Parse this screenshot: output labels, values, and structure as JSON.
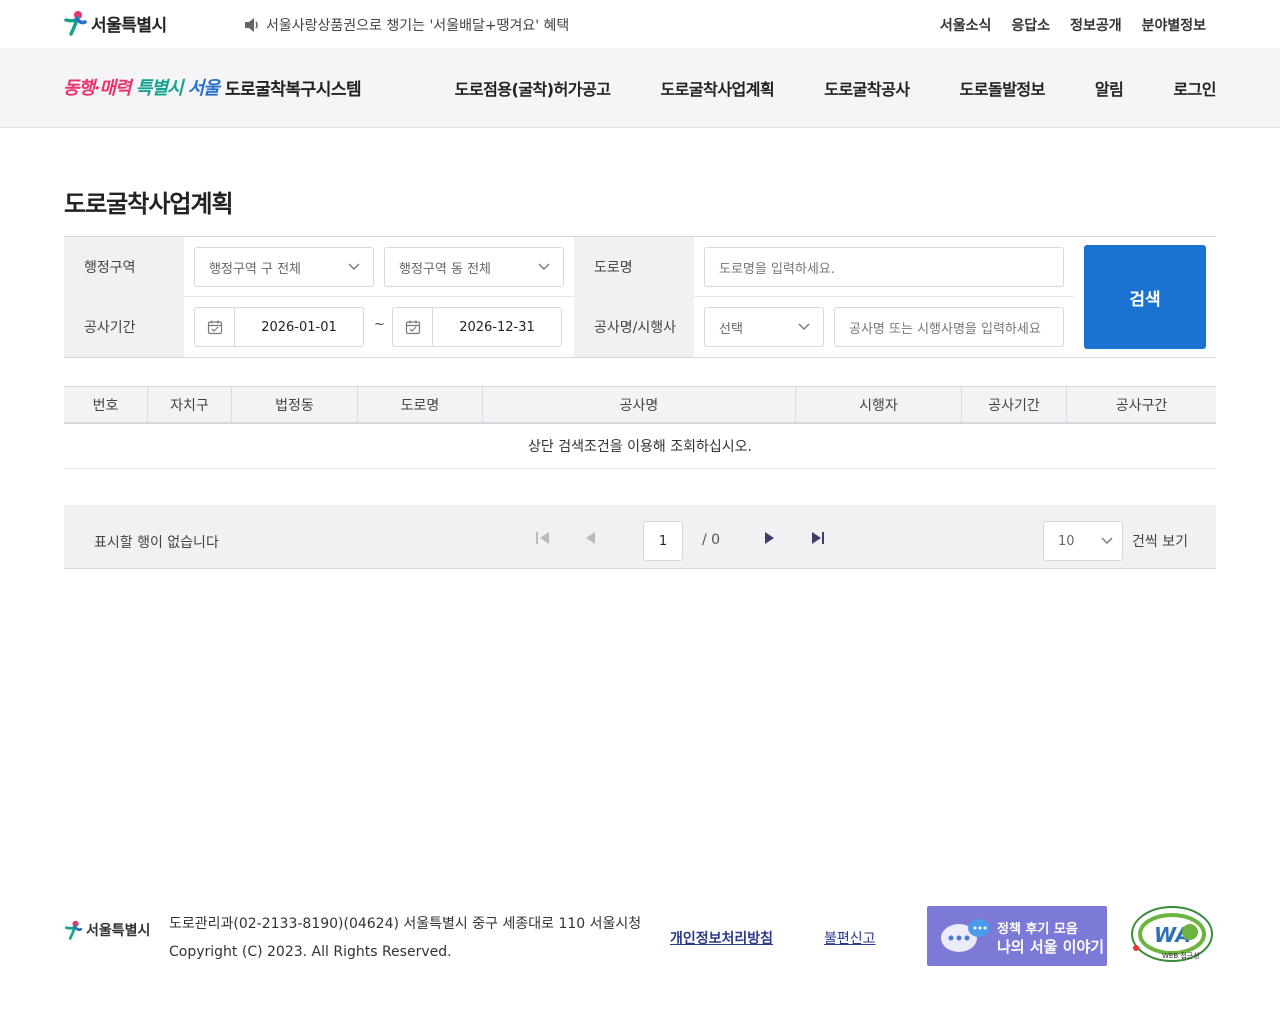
{
  "header": {
    "logo_text": "서울특별시",
    "notice": "서울사랑상품권으로 챙기는 '서울배달+땡겨요' 혜택",
    "util_links": [
      "서울소식",
      "응답소",
      "정보공개",
      "분야별정보"
    ]
  },
  "gnb": {
    "slogan": [
      "동행",
      "·",
      "매력",
      " 특별시 ",
      "서울"
    ],
    "system_name": "도로굴착복구시스템",
    "menu": [
      "도로점용(굴착)허가공고",
      "도로굴착사업계획",
      "도로굴착공사",
      "도로돌발정보",
      "알림",
      "로그인"
    ]
  },
  "page_title": "도로굴착사업계획",
  "search": {
    "district_label": "행정구역",
    "gu_select": "행정구역 구 전체",
    "dong_select": "행정구역 동 전체",
    "road_label": "도로명",
    "road_placeholder": "도로명을 입력하세요.",
    "period_label": "공사기간",
    "date_from": "2026-01-01",
    "date_sep": "~",
    "date_to": "2026-12-31",
    "name_label": "공사명/시행사",
    "type_select": "선택",
    "name_placeholder": "공사명 또는 시행사명을 입력하세요",
    "search_button": "검색"
  },
  "table": {
    "columns": [
      "번호",
      "자치구",
      "법정동",
      "도로명",
      "공사명",
      "시행자",
      "공사기간",
      "공사구간"
    ],
    "empty_message": "상단 검색조건을 이용해 조회하십시오."
  },
  "pager": {
    "info": "표시할 행이 없습니다",
    "page": "1",
    "total": "/ 0",
    "rows": "10",
    "rows_label": "건씩 보기"
  },
  "footer": {
    "logo_text": "서울특별시",
    "address": "도로관리과(02-2133-8190)(04624) 서울특별시 중구 세종대로 110 서울시청",
    "copyright": "Copyright (C) 2023. All Rights Reserved.",
    "privacy": "개인정보처리방침",
    "report": "불편신고",
    "banner_line1": "정책 후기 모음",
    "banner_line2": "나의 서울 이야기",
    "wa_text": "WA",
    "wa_sub": "WEB 접근성"
  },
  "colors": {
    "primary": "#1a73d1",
    "banner": "#7d79d6",
    "slogan_pink": "#e8336e",
    "slogan_green": "#17a28f"
  }
}
